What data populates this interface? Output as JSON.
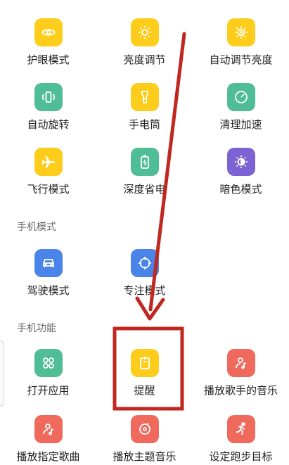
{
  "colors": {
    "yellow": "#fecd1c",
    "green": "#4fbd96",
    "purple": "#7b63d3",
    "blue": "#4a84e8",
    "red": "#ef6a5c",
    "annotation": "#c0281f"
  },
  "rows": [
    [
      {
        "label": "护眼模式",
        "icon": "eye-icon",
        "color": "yellow"
      },
      {
        "label": "亮度调节",
        "icon": "sun-icon",
        "color": "yellow"
      },
      {
        "label": "自动调节亮度",
        "icon": "auto-brightness-icon",
        "color": "yellow"
      }
    ],
    [
      {
        "label": "自动旋转",
        "icon": "rotate-icon",
        "color": "green"
      },
      {
        "label": "手电筒",
        "icon": "flashlight-icon",
        "color": "yellow"
      },
      {
        "label": "清理加速",
        "icon": "speedometer-icon",
        "color": "green"
      }
    ],
    [
      {
        "label": "飞行模式",
        "icon": "airplane-icon",
        "color": "yellow"
      },
      {
        "label": "深度省电",
        "icon": "battery-icon",
        "color": "green"
      },
      {
        "label": "暗色模式",
        "icon": "dark-mode-icon",
        "color": "purple"
      }
    ]
  ],
  "section_phone_mode": {
    "title": "手机模式",
    "items": [
      {
        "label": "驾驶模式",
        "icon": "car-icon",
        "color": "blue"
      },
      {
        "label": "专注模式",
        "icon": "focus-icon",
        "color": "blue"
      }
    ]
  },
  "section_phone_function": {
    "title": "手机功能",
    "items": [
      {
        "label": "打开应用",
        "icon": "apps-icon",
        "color": "green"
      },
      {
        "label": "提醒",
        "icon": "reminder-icon",
        "color": "yellow"
      },
      {
        "label": "播放歌手的音乐",
        "icon": "singer-music-icon",
        "color": "red"
      }
    ]
  },
  "bottom_row": [
    {
      "label": "播放指定歌曲",
      "icon": "song-icon",
      "color": "red"
    },
    {
      "label": "播放主题音乐",
      "icon": "disc-icon",
      "color": "red"
    },
    {
      "label": "设定跑步目标",
      "icon": "running-icon",
      "color": "red"
    }
  ],
  "annotation": {
    "highlight_target": "提醒"
  }
}
